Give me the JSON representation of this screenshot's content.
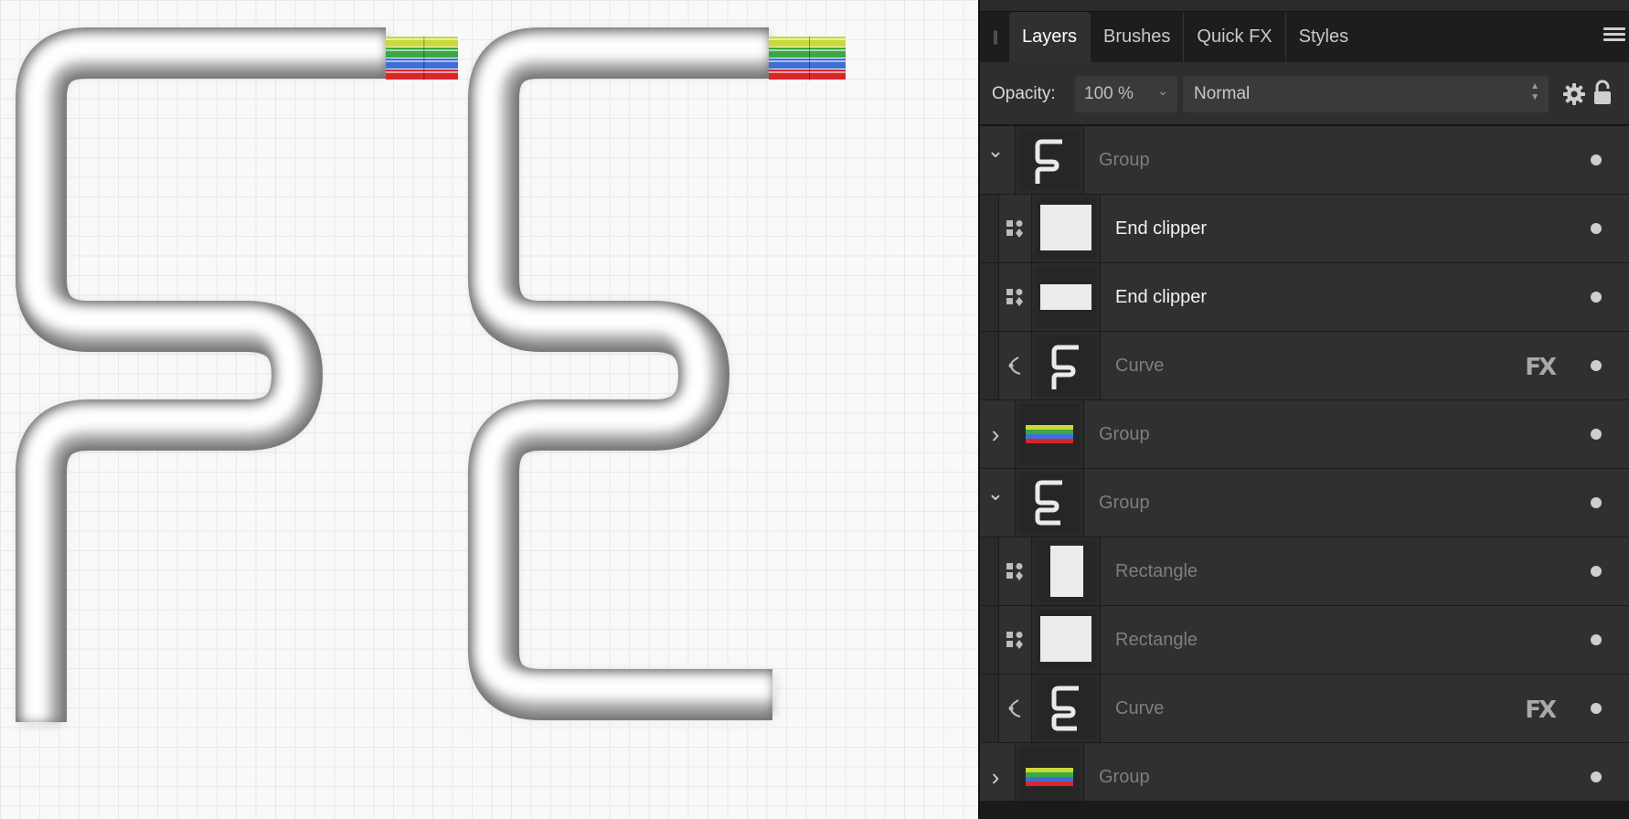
{
  "panel": {
    "tabs": [
      {
        "label": "Layers",
        "active": true
      },
      {
        "label": "Brushes",
        "active": false
      },
      {
        "label": "Quick FX",
        "active": false
      },
      {
        "label": "Styles",
        "active": false
      }
    ],
    "options": {
      "opacity_label": "Opacity:",
      "opacity_value": "100 %",
      "blend_mode": "Normal"
    },
    "layers": [
      {
        "name": "Group",
        "level": 0,
        "expander": "expanded",
        "thumb": "cable-f-icon",
        "bright": false,
        "fx": false
      },
      {
        "name": "End clipper",
        "level": 1,
        "expander": "mask",
        "thumb": "square-thumb",
        "bright": true,
        "fx": false
      },
      {
        "name": "End clipper",
        "level": 1,
        "expander": "mask",
        "thumb": "wide-rect-thumb",
        "bright": true,
        "fx": false
      },
      {
        "name": "Curve",
        "level": 1,
        "expander": "curve",
        "thumb": "cable-f-icon",
        "bright": false,
        "fx": true,
        "fx_label": "FX"
      },
      {
        "name": "Group",
        "level": 0,
        "expander": "collapsed",
        "thumb": "wires-thumb",
        "bright": false,
        "fx": false
      },
      {
        "name": "Group",
        "level": 0,
        "expander": "expanded",
        "thumb": "cable-e-icon",
        "bright": false,
        "fx": false
      },
      {
        "name": "Rectangle",
        "level": 1,
        "expander": "mask",
        "thumb": "tall-rect-thumb",
        "bright": false,
        "fx": false
      },
      {
        "name": "Rectangle",
        "level": 1,
        "expander": "mask",
        "thumb": "square-thumb",
        "bright": false,
        "fx": false
      },
      {
        "name": "Curve",
        "level": 1,
        "expander": "curve",
        "thumb": "cable-e-icon",
        "bright": false,
        "fx": true,
        "fx_label": "FX"
      },
      {
        "name": "Group",
        "level": 0,
        "expander": "collapsed",
        "thumb": "wires-thumb",
        "bright": false,
        "fx": false
      }
    ]
  },
  "canvas": {
    "wire_colors": [
      "#c9d93a",
      "#3aa845",
      "#3f6fd6",
      "#d8262a"
    ]
  }
}
